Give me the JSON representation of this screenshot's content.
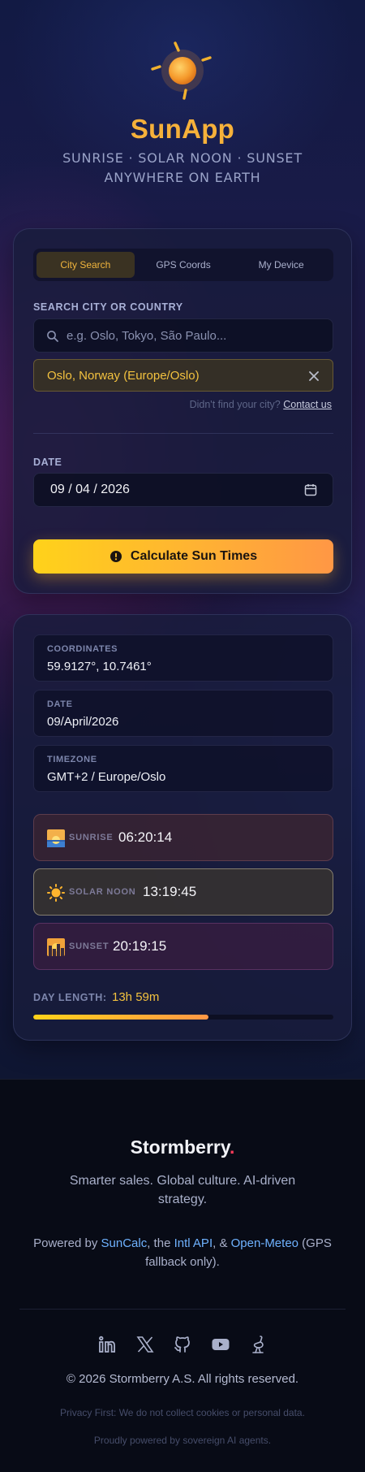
{
  "app": {
    "title": "SunApp",
    "subtitle": "SUNRISE · SOLAR NOON · SUNSET ANYWHERE ON EARTH"
  },
  "tabs": [
    {
      "label": "City Search",
      "active": true
    },
    {
      "label": "GPS Coords",
      "active": false
    },
    {
      "label": "My Device",
      "active": false
    }
  ],
  "search": {
    "label": "SEARCH CITY OR COUNTRY",
    "placeholder": "e.g. Oslo, Tokyo, São Paulo...",
    "value": "",
    "selected": "Oslo, Norway (Europe/Oslo)",
    "help_text": "Didn't find your city?",
    "help_link": "Contact us"
  },
  "date": {
    "label": "DATE",
    "value": "09 / 04 / 2026"
  },
  "calculate_button": "Calculate Sun Times",
  "results": {
    "coordinates": {
      "label": "COORDINATES",
      "value": "59.9127°, 10.7461°"
    },
    "date": {
      "label": "DATE",
      "value": "09/April/2026"
    },
    "timezone": {
      "label": "TIMEZONE",
      "value": "GMT+2 / Europe/Oslo"
    },
    "sunrise": {
      "label": "SUNRISE",
      "time": "06:20:14",
      "icon": "sunrise-icon"
    },
    "solar_noon": {
      "label": "SOLAR NOON",
      "time": "13:19:45",
      "icon": "sun-icon"
    },
    "sunset": {
      "label": "SUNSET",
      "time": "20:19:15",
      "icon": "sunset-icon"
    },
    "day_length": {
      "label": "DAY LENGTH:",
      "value": "13h 59m",
      "fraction": 0.583
    }
  },
  "footer": {
    "brand": "Stormberry",
    "brand_dot": ".",
    "tagline": "Smarter sales. Global culture. AI-driven strategy.",
    "powered_prefix": "Powered by ",
    "powered_link1": "SunCalc",
    "powered_mid1": ", the ",
    "powered_link2": "Intl API",
    "powered_mid2": ", & ",
    "powered_link3": "Open-Meteo",
    "powered_suffix": " (GPS fallback only).",
    "socials": [
      "linkedin-icon",
      "x-icon",
      "github-icon",
      "youtube-icon",
      "ostrich-icon"
    ],
    "copyright": "© 2026 Stormberry A.S. All rights reserved.",
    "privacy": "Privacy First: We do not collect cookies or personal data.",
    "agents": "Proudly powered by sovereign AI agents."
  },
  "colors": {
    "accent": "#f6b13a",
    "selected_text": "#f3c23f",
    "link": "#6fb2ff",
    "brand_dot": "#ff3b5a"
  }
}
